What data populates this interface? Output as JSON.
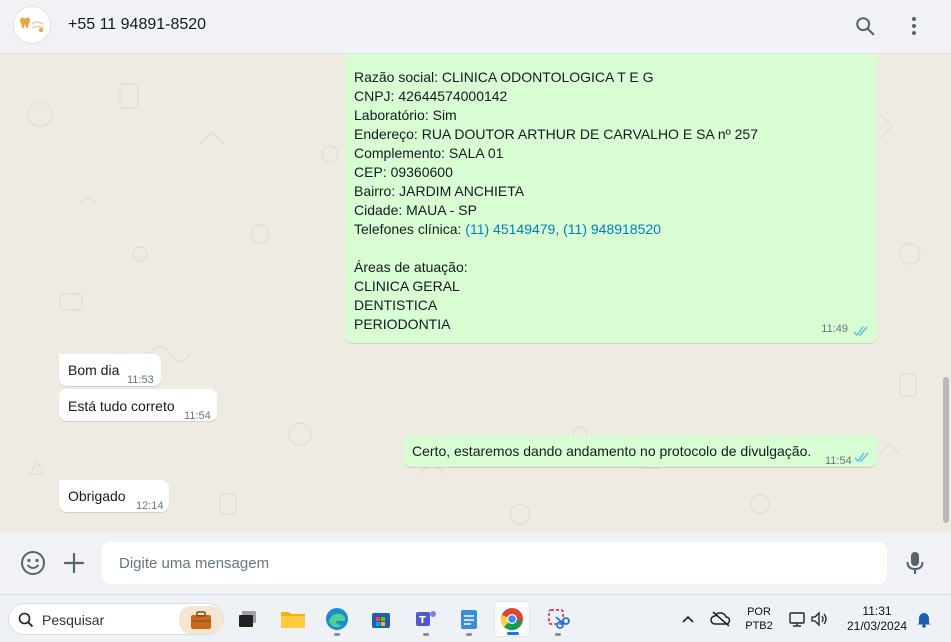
{
  "header": {
    "contact_name": "+55 11 94891-8520",
    "search_icon": "search-icon",
    "menu_icon": "more-vertical-icon"
  },
  "messages": {
    "clinic_info": {
      "lines": [
        "Razão social: CLINICA ODONTOLOGICA T E G",
        "CNPJ: 42644574000142",
        "Laboratório: Sim",
        "Endereço: RUA DOUTOR ARTHUR DE CARVALHO E SA nº 257",
        "Complemento: SALA 01",
        "CEP: 09360600",
        "Bairro: JARDIM ANCHIETA",
        "Cidade: MAUA - SP"
      ],
      "phones_label": "Telefones clínica: ",
      "phone_1": "(11) 45149479",
      "phone_sep": ", ",
      "phone_2": "(11) 948918520",
      "areas_title": "Áreas de atuação:",
      "areas": [
        "CLINICA GERAL",
        "DENTISTICA",
        "PERIODONTIA"
      ],
      "time": "11:49"
    },
    "bom_dia": {
      "text": "Bom dia",
      "time": "11:53"
    },
    "correto": {
      "text": "Está tudo correto",
      "time": "11:54"
    },
    "certo": {
      "text": "Certo, estaremos dando andamento no protocolo de divulgação.",
      "time": "11:54"
    },
    "obrigado": {
      "text": "Obrigado",
      "time": "12:14"
    }
  },
  "composer": {
    "placeholder": "Digite uma mensagem",
    "emoji_icon": "emoji-icon",
    "attach_icon": "plus-icon",
    "mic_icon": "microphone-icon"
  },
  "taskbar": {
    "search_placeholder": "Pesquisar",
    "lang_line1": "POR",
    "lang_line2": "PTB2",
    "clock_time": "11:31",
    "clock_date": "21/03/2024"
  },
  "colors": {
    "outgoing_bubble": "#d9fdd3",
    "incoming_bubble": "#ffffff",
    "chat_background": "#efeae2",
    "link": "#027eb5",
    "read_ticks": "#53bdeb"
  }
}
